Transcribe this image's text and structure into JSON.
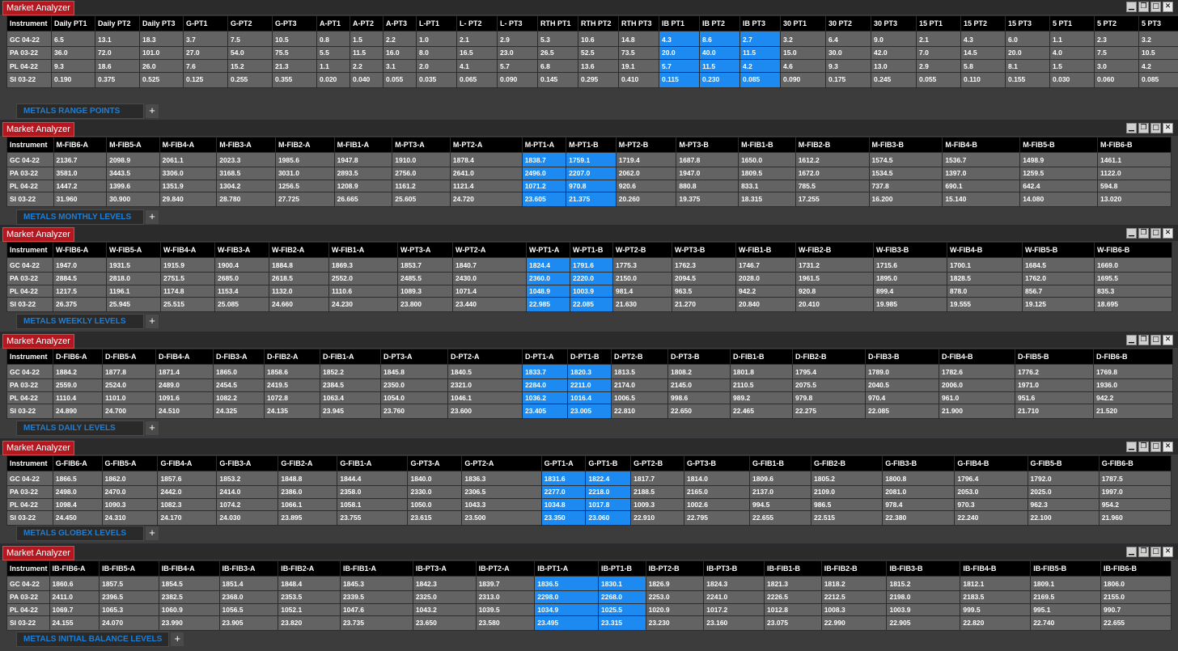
{
  "panels": [
    {
      "title": "Market Analyzer",
      "tab_label": "METALS RANGE POINTS",
      "columns": [
        "Instrument",
        "Daily PT1",
        "Daily PT2",
        "Daily PT3",
        "G-PT1",
        "G-PT2",
        "G-PT3",
        "A-PT1",
        "A-PT2",
        "A-PT3",
        "L-PT1",
        "L- PT2",
        "L- PT3",
        "RTH PT1",
        "RTH PT2",
        "RTH PT3",
        "IB PT1",
        "IB PT2",
        "IB PT3",
        "30 PT1",
        "30 PT2",
        "30 PT3",
        "15 PT1",
        "15 PT2",
        "15 PT3",
        "5 PT1",
        "5 PT2",
        "5 PT3"
      ],
      "highlight": [
        16,
        17,
        18
      ],
      "rows": [
        [
          "GC 04-22",
          "6.5",
          "13.1",
          "18.3",
          "3.7",
          "7.5",
          "10.5",
          "0.8",
          "1.5",
          "2.2",
          "1.0",
          "2.1",
          "2.9",
          "5.3",
          "10.6",
          "14.8",
          "4.3",
          "8.6",
          "2.7",
          "3.2",
          "6.4",
          "9.0",
          "2.1",
          "4.3",
          "6.0",
          "1.1",
          "2.3",
          "3.2"
        ],
        [
          "PA 03-22",
          "36.0",
          "72.0",
          "101.0",
          "27.0",
          "54.0",
          "75.5",
          "5.5",
          "11.5",
          "16.0",
          "8.0",
          "16.5",
          "23.0",
          "26.5",
          "52.5",
          "73.5",
          "20.0",
          "40.0",
          "11.5",
          "15.0",
          "30.0",
          "42.0",
          "7.0",
          "14.5",
          "20.0",
          "4.0",
          "7.5",
          "10.5"
        ],
        [
          "PL 04-22",
          "9.3",
          "18.6",
          "26.0",
          "7.6",
          "15.2",
          "21.3",
          "1.1",
          "2.2",
          "3.1",
          "2.0",
          "4.1",
          "5.7",
          "6.8",
          "13.6",
          "19.1",
          "5.7",
          "11.5",
          "4.2",
          "4.6",
          "9.3",
          "13.0",
          "2.9",
          "5.8",
          "8.1",
          "1.5",
          "3.0",
          "4.2"
        ],
        [
          "SI 03-22",
          "0.190",
          "0.375",
          "0.525",
          "0.125",
          "0.255",
          "0.355",
          "0.020",
          "0.040",
          "0.055",
          "0.035",
          "0.065",
          "0.090",
          "0.145",
          "0.295",
          "0.410",
          "0.115",
          "0.230",
          "0.085",
          "0.090",
          "0.175",
          "0.245",
          "0.055",
          "0.110",
          "0.155",
          "0.030",
          "0.060",
          "0.085"
        ]
      ]
    },
    {
      "title": "Market Analyzer",
      "tab_label": "METALS MONTHLY LEVELS",
      "columns": [
        "Instrument",
        "M-FIB6-A",
        "M-FIB5-A",
        "M-FIB4-A",
        "M-FIB3-A",
        "M-FIB2-A",
        "M-FIB1-A",
        "M-PT3-A",
        "M-PT2-A",
        "M-PT1-A",
        "M-PT1-B",
        "M-PT2-B",
        "M-PT3-B",
        "M-FIB1-B",
        "M-FIB2-B",
        "M-FIB3-B",
        "M-FIB4-B",
        "M-FIB5-B",
        "M-FIB6-B"
      ],
      "highlight": [
        9,
        10
      ],
      "rows": [
        [
          "GC 04-22",
          "2136.7",
          "2098.9",
          "2061.1",
          "2023.3",
          "1985.6",
          "1947.8",
          "1910.0",
          "1878.4",
          "1838.7",
          "1759.1",
          "1719.4",
          "1687.8",
          "1650.0",
          "1612.2",
          "1574.5",
          "1536.7",
          "1498.9",
          "1461.1"
        ],
        [
          "PA 03-22",
          "3581.0",
          "3443.5",
          "3306.0",
          "3168.5",
          "3031.0",
          "2893.5",
          "2756.0",
          "2641.0",
          "2496.0",
          "2207.0",
          "2062.0",
          "1947.0",
          "1809.5",
          "1672.0",
          "1534.5",
          "1397.0",
          "1259.5",
          "1122.0"
        ],
        [
          "PL 04-22",
          "1447.2",
          "1399.6",
          "1351.9",
          "1304.2",
          "1256.5",
          "1208.9",
          "1161.2",
          "1121.4",
          "1071.2",
          "970.8",
          "920.6",
          "880.8",
          "833.1",
          "785.5",
          "737.8",
          "690.1",
          "642.4",
          "594.8"
        ],
        [
          "SI 03-22",
          "31.960",
          "30.900",
          "29.840",
          "28.780",
          "27.725",
          "26.665",
          "25.605",
          "24.720",
          "23.605",
          "21.375",
          "20.260",
          "19.375",
          "18.315",
          "17.255",
          "16.200",
          "15.140",
          "14.080",
          "13.020"
        ]
      ]
    },
    {
      "title": "Market Analyzer",
      "tab_label": "METALS WEEKLY LEVELS",
      "columns": [
        "Instrument",
        "W-FIB6-A",
        "W-FIB5-A",
        "W-FIB4-A",
        "W-FIB3-A",
        "W-FIB2-A",
        "W-FIB1-A",
        "W-PT3-A",
        "W-PT2-A",
        "W-PT1-A",
        "W-PT1-B",
        "W-PT2-B",
        "W-PT3-B",
        "W-FIB1-B",
        "W-FIB2-B",
        "W-FIB3-B",
        "W-FIB4-B",
        "W-FIB5-B",
        "W-FIB6-B"
      ],
      "highlight": [
        9,
        10
      ],
      "rows": [
        [
          "GC 04-22",
          "1947.0",
          "1931.5",
          "1915.9",
          "1900.4",
          "1884.8",
          "1869.3",
          "1853.7",
          "1840.7",
          "1824.4",
          "1791.6",
          "1775.3",
          "1762.3",
          "1746.7",
          "1731.2",
          "1715.6",
          "1700.1",
          "1684.5",
          "1669.0"
        ],
        [
          "PA 03-22",
          "2884.5",
          "2818.0",
          "2751.5",
          "2685.0",
          "2618.5",
          "2552.0",
          "2485.5",
          "2430.0",
          "2360.0",
          "2220.0",
          "2150.0",
          "2094.5",
          "2028.0",
          "1961.5",
          "1895.0",
          "1828.5",
          "1762.0",
          "1695.5"
        ],
        [
          "PL 04-22",
          "1217.5",
          "1196.1",
          "1174.8",
          "1153.4",
          "1132.0",
          "1110.6",
          "1089.3",
          "1071.4",
          "1048.9",
          "1003.9",
          "981.4",
          "963.5",
          "942.2",
          "920.8",
          "899.4",
          "878.0",
          "856.7",
          "835.3"
        ],
        [
          "SI 03-22",
          "26.375",
          "25.945",
          "25.515",
          "25.085",
          "24.660",
          "24.230",
          "23.800",
          "23.440",
          "22.985",
          "22.085",
          "21.630",
          "21.270",
          "20.840",
          "20.410",
          "19.985",
          "19.555",
          "19.125",
          "18.695"
        ]
      ]
    },
    {
      "title": "Market Analyzer",
      "tab_label": "METALS DAILY LEVELS",
      "columns": [
        "Instrument",
        "D-FIB6-A",
        "D-FIB5-A",
        "D-FIB4-A",
        "D-FIB3-A",
        "D-FIB2-A",
        "D-FIB1-A",
        "D-PT3-A",
        "D-PT2-A",
        "D-PT1-A",
        "D-PT1-B",
        "D-PT2-B",
        "D-PT3-B",
        "D-FIB1-B",
        "D-FIB2-B",
        "D-FIB3-B",
        "D-FIB4-B",
        "D-FIB5-B",
        "D-FIB6-B"
      ],
      "highlight": [
        9,
        10
      ],
      "rows": [
        [
          "GC 04-22",
          "1884.2",
          "1877.8",
          "1871.4",
          "1865.0",
          "1858.6",
          "1852.2",
          "1845.8",
          "1840.5",
          "1833.7",
          "1820.3",
          "1813.5",
          "1808.2",
          "1801.8",
          "1795.4",
          "1789.0",
          "1782.6",
          "1776.2",
          "1769.8"
        ],
        [
          "PA 03-22",
          "2559.0",
          "2524.0",
          "2489.0",
          "2454.5",
          "2419.5",
          "2384.5",
          "2350.0",
          "2321.0",
          "2284.0",
          "2211.0",
          "2174.0",
          "2145.0",
          "2110.5",
          "2075.5",
          "2040.5",
          "2006.0",
          "1971.0",
          "1936.0"
        ],
        [
          "PL 04-22",
          "1110.4",
          "1101.0",
          "1091.6",
          "1082.2",
          "1072.8",
          "1063.4",
          "1054.0",
          "1046.1",
          "1036.2",
          "1016.4",
          "1006.5",
          "998.6",
          "989.2",
          "979.8",
          "970.4",
          "961.0",
          "951.6",
          "942.2"
        ],
        [
          "SI 03-22",
          "24.890",
          "24.700",
          "24.510",
          "24.325",
          "24.135",
          "23.945",
          "23.760",
          "23.600",
          "23.405",
          "23.005",
          "22.810",
          "22.650",
          "22.465",
          "22.275",
          "22.085",
          "21.900",
          "21.710",
          "21.520"
        ]
      ]
    },
    {
      "title": "Market Analyzer",
      "tab_label": "METALS GLOBEX LEVELS",
      "columns": [
        "Instrument",
        "G-FIB6-A",
        "G-FIB5-A",
        "G-FIB4-A",
        "G-FIB3-A",
        "G-FIB2-A",
        "G-FIB1-A",
        "G-PT3-A",
        "G-PT2-A",
        "G-PT1-A",
        "G-PT1-B",
        "G-PT2-B",
        "G-PT3-B",
        "G-FIB1-B",
        "G-FIB2-B",
        "G-FIB3-B",
        "G-FIB4-B",
        "G-FIB5-B",
        "G-FIB6-B"
      ],
      "highlight": [
        9,
        10
      ],
      "rows": [
        [
          "GC 04-22",
          "1866.5",
          "1862.0",
          "1857.6",
          "1853.2",
          "1848.8",
          "1844.4",
          "1840.0",
          "1836.3",
          "1831.6",
          "1822.4",
          "1817.7",
          "1814.0",
          "1809.6",
          "1805.2",
          "1800.8",
          "1796.4",
          "1792.0",
          "1787.5"
        ],
        [
          "PA 03-22",
          "2498.0",
          "2470.0",
          "2442.0",
          "2414.0",
          "2386.0",
          "2358.0",
          "2330.0",
          "2306.5",
          "2277.0",
          "2218.0",
          "2188.5",
          "2165.0",
          "2137.0",
          "2109.0",
          "2081.0",
          "2053.0",
          "2025.0",
          "1997.0"
        ],
        [
          "PL 04-22",
          "1098.4",
          "1090.3",
          "1082.3",
          "1074.2",
          "1066.1",
          "1058.1",
          "1050.0",
          "1043.3",
          "1034.8",
          "1017.8",
          "1009.3",
          "1002.6",
          "994.5",
          "986.5",
          "978.4",
          "970.3",
          "962.3",
          "954.2"
        ],
        [
          "SI 03-22",
          "24.450",
          "24.310",
          "24.170",
          "24.030",
          "23.895",
          "23.755",
          "23.615",
          "23.500",
          "23.350",
          "23.060",
          "22.910",
          "22.795",
          "22.655",
          "22.515",
          "22.380",
          "22.240",
          "22.100",
          "21.960"
        ]
      ]
    },
    {
      "title": "Market Analyzer",
      "tab_label": "METALS INITIAL BALANCE LEVELS",
      "columns": [
        "Instrument",
        "IB-FIB6-A",
        "IB-FIB5-A",
        "IB-FIB4-A",
        "IB-FIB3-A",
        "IB-FIB2-A",
        "IB-FIB1-A",
        "IB-PT3-A",
        "IB-PT2-A",
        "IB-PT1-A",
        "IB-PT1-B",
        "IB-PT2-B",
        "IB-PT3-B",
        "IB-FIB1-B",
        "IB-FIB2-B",
        "IB-FIB3-B",
        "IB-FIB4-B",
        "IB-FIB5-B",
        "IB-FIB6-B"
      ],
      "highlight": [
        9,
        10
      ],
      "rows": [
        [
          "GC 04-22",
          "1860.6",
          "1857.5",
          "1854.5",
          "1851.4",
          "1848.4",
          "1845.3",
          "1842.3",
          "1839.7",
          "1836.5",
          "1830.1",
          "1826.9",
          "1824.3",
          "1821.3",
          "1818.2",
          "1815.2",
          "1812.1",
          "1809.1",
          "1806.0"
        ],
        [
          "PA 03-22",
          "2411.0",
          "2396.5",
          "2382.5",
          "2368.0",
          "2353.5",
          "2339.5",
          "2325.0",
          "2313.0",
          "2298.0",
          "2268.0",
          "2253.0",
          "2241.0",
          "2226.5",
          "2212.5",
          "2198.0",
          "2183.5",
          "2169.5",
          "2155.0"
        ],
        [
          "PL 04-22",
          "1069.7",
          "1065.3",
          "1060.9",
          "1056.5",
          "1052.1",
          "1047.6",
          "1043.2",
          "1039.5",
          "1034.9",
          "1025.5",
          "1020.9",
          "1017.2",
          "1012.8",
          "1008.3",
          "1003.9",
          "999.5",
          "995.1",
          "990.7"
        ],
        [
          "SI 03-22",
          "24.155",
          "24.070",
          "23.990",
          "23.905",
          "23.820",
          "23.735",
          "23.650",
          "23.580",
          "23.495",
          "23.315",
          "23.230",
          "23.160",
          "23.075",
          "22.990",
          "22.905",
          "22.820",
          "22.740",
          "22.655"
        ]
      ]
    }
  ],
  "window_controls": {
    "minimize": "▁",
    "restore": "❐",
    "maximize": "□",
    "close": "✕"
  },
  "add_tab_label": "+",
  "colors": {
    "highlight": "#1c8af0",
    "title_bg": "#b3171f",
    "tab_text": "#1e7fd6"
  }
}
